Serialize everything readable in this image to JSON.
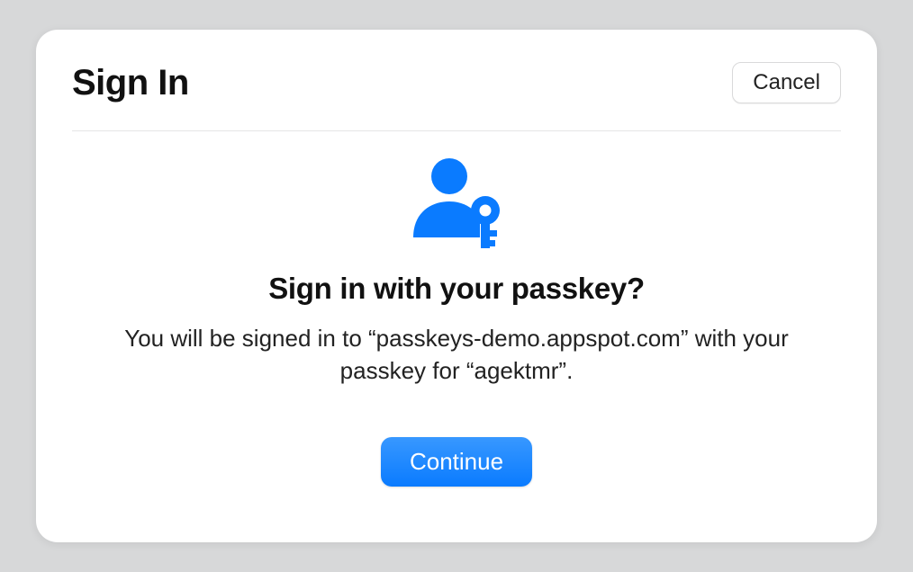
{
  "header": {
    "title": "Sign In",
    "cancel_label": "Cancel"
  },
  "prompt": {
    "title": "Sign in with your passkey?",
    "description": "You will be signed in to “passkeys-demo.appspot.com” with your passkey for “agektmr”.",
    "continue_label": "Continue"
  },
  "icon": {
    "name": "passkey-icon",
    "color": "#0a7bff"
  }
}
